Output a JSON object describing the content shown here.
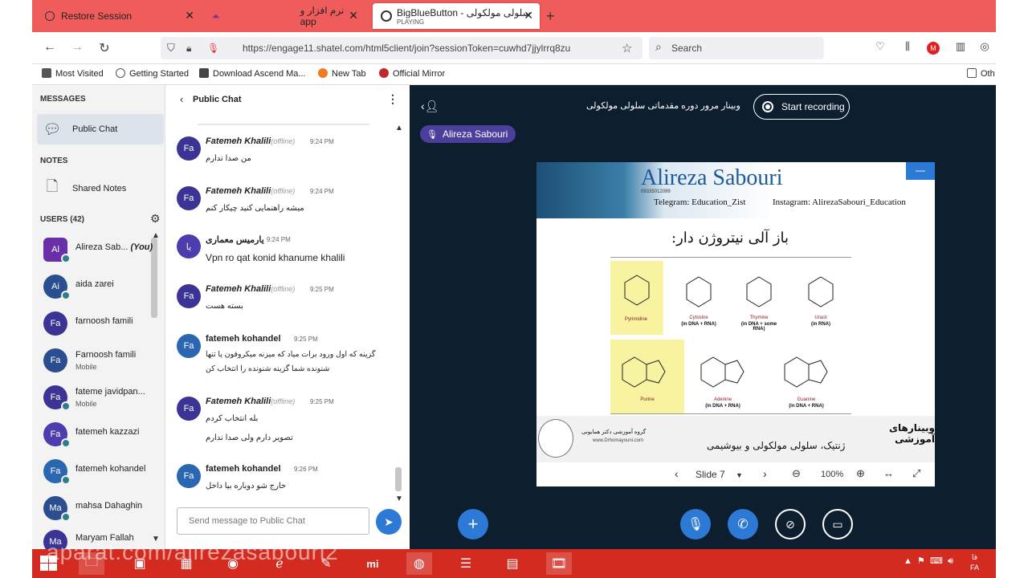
{
  "browser": {
    "tabs": [
      {
        "label": "Restore Session",
        "icon": "restore-session-icon"
      },
      {
        "label": "نرم افزار و app",
        "icon": "app-icon"
      },
      {
        "label": "BigBlueButton - سلولی مولکولی",
        "sublabel": "PLAYING",
        "icon": "bbb-icon"
      }
    ],
    "url": "https://engage11.shatel.com/html5client/join?sessionToken=cuwhd7jjylrrq8zu",
    "search_placeholder": "Search",
    "bookmarks": [
      "Most Visited",
      "Getting Started",
      "Download Ascend Ma...",
      "New Tab",
      "Official Mirror",
      "Oth"
    ]
  },
  "sidebar": {
    "messages_heading": "MESSAGES",
    "public_chat": "Public Chat",
    "notes_heading": "NOTES",
    "shared_notes": "Shared Notes",
    "users_heading": "USERS (42)",
    "users": [
      {
        "initials": "Al",
        "name": "Alireza Sab...",
        "you": "(You)",
        "color": "#6a2ea8"
      },
      {
        "initials": "Ai",
        "name": "aida zarei",
        "color": "#2a4e8f"
      },
      {
        "initials": "Fa",
        "name": "farnoosh famili",
        "color": "#3b3494"
      },
      {
        "initials": "Fa",
        "name": "Farnoosh famili",
        "sub": "Mobile",
        "color": "#2a4e8f"
      },
      {
        "initials": "Fa",
        "name": "fateme javidpan...",
        "sub": "Mobile",
        "color": "#3b3494"
      },
      {
        "initials": "Fa",
        "name": "fatemeh kazzazi",
        "color": "#4b3dad"
      },
      {
        "initials": "Fa",
        "name": "fatemeh kohandel",
        "color": "#2a67b0"
      },
      {
        "initials": "Ma",
        "name": "mahsa Dahaghin",
        "color": "#2a4e8f"
      },
      {
        "initials": "Ma",
        "name": "Maryam Fallah",
        "color": "#3b3494"
      }
    ]
  },
  "chat": {
    "title": "Public Chat",
    "messages": [
      {
        "initials": "Fa",
        "name": "Fatemeh Khalili",
        "status": "(offline)",
        "time": "9:24 PM",
        "lines": [
          "من صدا ندارم"
        ],
        "color": "#3b3494"
      },
      {
        "initials": "Fa",
        "name": "Fatemeh Khalili",
        "status": "(offline)",
        "time": "9:24 PM",
        "lines": [
          "میشه راهنمایی کنید چیکار کنم"
        ],
        "color": "#3b3494"
      },
      {
        "initials": "یا",
        "name": "یارمیس معماری",
        "status": "",
        "time": "9:24 PM",
        "lines": [
          "Vpn ro qat konid khanume khalili"
        ],
        "color": "#4b3dad"
      },
      {
        "initials": "Fa",
        "name": "Fatemeh Khalili",
        "status": "(offline)",
        "time": "9:25 PM",
        "lines": [
          "بسته هست"
        ],
        "color": "#3b3494"
      },
      {
        "initials": "Fa",
        "name": "fatemeh kohandel",
        "status": "",
        "time": "9:25 PM",
        "lines": [
          "گزینه که اول ورود برات میاد که میزنه میکروفون یا تنها",
          "شنونده شما گزینه شنونده را انتخاب کن"
        ],
        "color": "#2a67b0"
      },
      {
        "initials": "Fa",
        "name": "Fatemeh Khalili",
        "status": "(offline)",
        "time": "9:25 PM",
        "lines": [
          "بله انتخاب کردم",
          "تصویر دارم ولی صدا ندارم"
        ],
        "color": "#3b3494"
      },
      {
        "initials": "Fa",
        "name": "fatemeh kohandel",
        "status": "",
        "time": "9:26 PM",
        "lines": [
          "خارج شو دوباره بیا داخل"
        ],
        "color": "#2a67b0"
      }
    ],
    "input_placeholder": "Send message to Public Chat"
  },
  "main": {
    "presentation_title": "وبینار مرور دوره مقدماتی سلولی مولکولی",
    "record_label": "Start recording",
    "talker": "Alireza Sabouri",
    "slide": {
      "name": "Alireza Sabouri",
      "phone": "09335012099",
      "telegram": "Telegram: Education_Zist",
      "instagram": "Instagram: AlirezaSabouri_Education",
      "fa_title": "باز آلی نیتروژن دار:",
      "pyrimidine_label": "Pyrimidine",
      "purine_label": "Purine",
      "bases": [
        {
          "name": "Cytosine",
          "sub": "(in DNA + RNA)"
        },
        {
          "name": "Thymine",
          "sub": "(in DNA + some RNA)"
        },
        {
          "name": "Uracil",
          "sub": "(in RNA)"
        },
        {
          "name": "Adenine",
          "sub": "(in DNA + RNA)"
        },
        {
          "name": "Guanine",
          "sub": "(in DNA + RNA)"
        }
      ],
      "footer_line1": "وبینارهای آموزشی",
      "footer_line2": "ژنتیک، سلولی مولکولی و بیوشیمی",
      "footer_group": "گروه آموزشی دکتر همایونی",
      "footer_site": "www.Drhomayouni.com"
    },
    "slide_toolbar": {
      "slide_label": "Slide 7",
      "zoom": "100%"
    }
  },
  "taskbar": {
    "watermark": "aparat.com/alirezasabouri2",
    "lang": "FA",
    "lang_top": "فا"
  }
}
